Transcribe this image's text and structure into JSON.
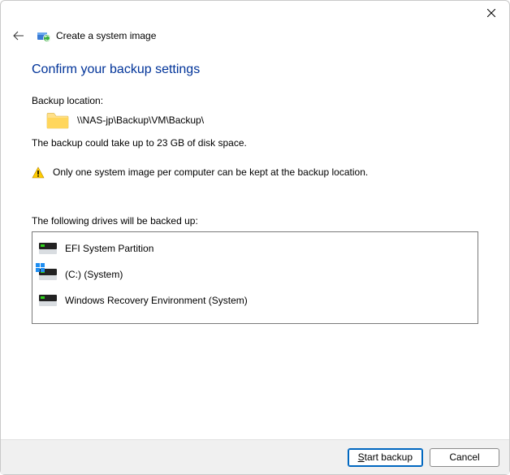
{
  "window": {
    "title": "Create a system image"
  },
  "page": {
    "heading": "Confirm your backup settings",
    "backup_location_label": "Backup location:",
    "backup_location_path": "\\\\NAS-jp\\Backup\\VM\\Backup\\",
    "size_text": "The backup could take up to 23 GB of disk space.",
    "warning_text": "Only one system image per computer can be kept at the backup location.",
    "drives_label": "The following drives will be backed up:",
    "drives": [
      {
        "name": "EFI System Partition",
        "has_win_badge": false
      },
      {
        "name": "(C:) (System)",
        "has_win_badge": true
      },
      {
        "name": "Windows Recovery Environment (System)",
        "has_win_badge": false
      }
    ]
  },
  "buttons": {
    "start_backup_prefix": "S",
    "start_backup_rest": "tart backup",
    "cancel": "Cancel"
  }
}
